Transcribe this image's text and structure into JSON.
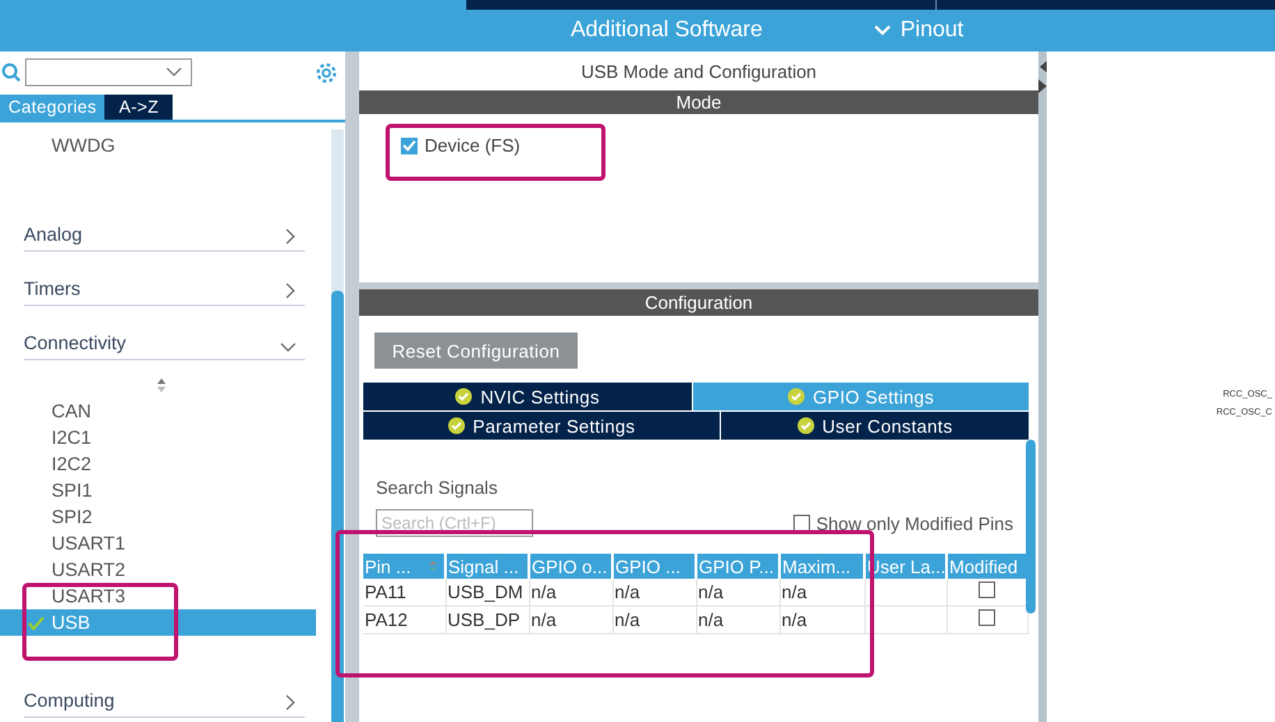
{
  "top_bar": {
    "title": "Additional Software",
    "pinout_label": "Pinout"
  },
  "sidebar": {
    "tabs": [
      {
        "label": "Categories",
        "selected": true
      },
      {
        "label": "A->Z",
        "selected": false
      }
    ],
    "items": [
      {
        "kind": "peripheral",
        "label": "WWDG",
        "selected": false,
        "configured": false
      },
      {
        "kind": "category",
        "label": "Analog",
        "expanded": false
      },
      {
        "kind": "category",
        "label": "Timers",
        "expanded": false
      },
      {
        "kind": "category",
        "label": "Connectivity",
        "expanded": true,
        "children": [
          {
            "label": "CAN",
            "selected": false,
            "configured": false
          },
          {
            "label": "I2C1",
            "selected": false,
            "configured": false
          },
          {
            "label": "I2C2",
            "selected": false,
            "configured": false
          },
          {
            "label": "SPI1",
            "selected": false,
            "configured": false
          },
          {
            "label": "SPI2",
            "selected": false,
            "configured": false
          },
          {
            "label": "USART1",
            "selected": false,
            "configured": false
          },
          {
            "label": "USART2",
            "selected": false,
            "configured": false
          },
          {
            "label": "USART3",
            "selected": false,
            "configured": false
          },
          {
            "label": "USB",
            "selected": true,
            "configured": true
          }
        ]
      },
      {
        "kind": "category",
        "label": "Computing",
        "expanded": false
      }
    ]
  },
  "mode_panel": {
    "title": "USB Mode and Configuration",
    "header": "Mode",
    "options": [
      {
        "label": "Device (FS)",
        "checked": true
      }
    ]
  },
  "configuration": {
    "header": "Configuration",
    "reset_button": "Reset Configuration",
    "tab_rows": [
      {
        "tabs": [
          {
            "label": "NVIC Settings",
            "selected": false
          },
          {
            "label": "GPIO Settings",
            "selected": true
          }
        ]
      },
      {
        "tabs": [
          {
            "label": "Parameter Settings",
            "selected": false
          },
          {
            "label": "User Constants",
            "selected": false
          }
        ]
      }
    ],
    "search": {
      "label": "Search Signals",
      "placeholder": "Search (Crtl+F)"
    },
    "filter": {
      "label": "Show only Modified Pins",
      "checked": false
    },
    "table": {
      "columns": [
        "Pin ...",
        "Signal ...",
        "GPIO o...",
        "GPIO ...",
        "GPIO P...",
        "Maxim...",
        "User La...",
        "Modified"
      ],
      "rows": [
        {
          "cells": [
            "PA11",
            "USB_DM",
            "n/a",
            "n/a",
            "n/a",
            "n/a"
          ],
          "modified": false
        },
        {
          "cells": [
            "PA12",
            "USB_DP",
            "n/a",
            "n/a",
            "n/a",
            "n/a"
          ],
          "modified": false
        }
      ]
    }
  },
  "canvas": {
    "pin_labels": [
      "RCC_OSC_",
      "RCC_OSC_C"
    ]
  }
}
